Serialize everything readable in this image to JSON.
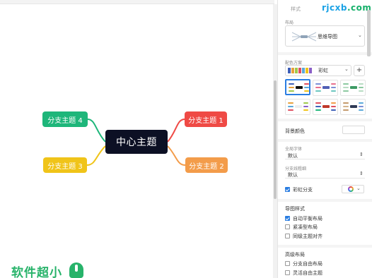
{
  "canvas": {
    "center": "中心主题",
    "branches": [
      {
        "label": "分支主题 1",
        "color": "#ef4a45"
      },
      {
        "label": "分支主题 2",
        "color": "#f39c4a"
      },
      {
        "label": "分支主题 3",
        "color": "#f0c419"
      },
      {
        "label": "分支主题 4",
        "color": "#1eb67a"
      }
    ]
  },
  "brand": {
    "text": "软件超小"
  },
  "watermark": {
    "part1": "rjcxb",
    "part2": ".com"
  },
  "panel": {
    "tab": "样式",
    "structure": {
      "label": "布局",
      "value": "思维导图"
    },
    "theme": {
      "label": "配色方案",
      "value": "彩虹",
      "add": "+",
      "swatches": [
        "#3e5fb8",
        "#e8a13c",
        "#9fc94b",
        "#e04f5f",
        "#5aa9d9",
        "#f0c419",
        "#8a5fc7"
      ]
    },
    "background": {
      "label": "背景颜色"
    },
    "font": {
      "label": "全局字体",
      "value": "默认"
    },
    "line_thickness": {
      "label": "分支线粗细",
      "value": "默认"
    },
    "rainbow": {
      "label": "彩虹分支",
      "checked": true
    },
    "layout_style": {
      "title": "导图样式",
      "options": [
        {
          "label": "自动平衡布局",
          "checked": true
        },
        {
          "label": "紧凑型布局",
          "checked": false
        },
        {
          "label": "同级主题对齐",
          "checked": false
        }
      ]
    },
    "advanced": {
      "title": "高级布局",
      "options": [
        {
          "label": "分支自由布局",
          "checked": false
        },
        {
          "label": "灵活自由主题",
          "checked": false
        }
      ]
    }
  }
}
